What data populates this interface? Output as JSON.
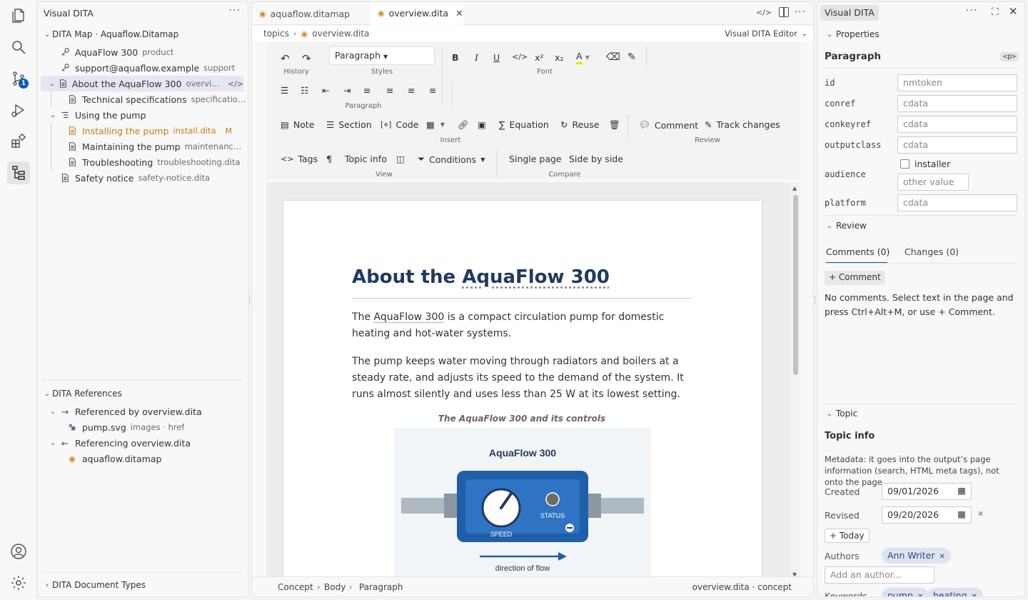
{
  "activity_bar": {
    "scm_badge": "1"
  },
  "sidebar": {
    "title": "Visual DITA",
    "map_section": "DITA Map · Aquaflow.Ditamap",
    "items": [
      {
        "label": "AquaFlow 300",
        "desc": "product"
      },
      {
        "label": "support@aquaflow.example",
        "desc": "support"
      },
      {
        "label": "About the AquaFlow 300",
        "desc": "overview...."
      },
      {
        "label": "Technical specifications",
        "desc": "specifications..."
      },
      {
        "label": "Using the pump",
        "desc": ""
      },
      {
        "label": "Installing the pump",
        "desc": "install.dita",
        "status": "M"
      },
      {
        "label": "Maintaining the pump",
        "desc": "maintenance...."
      },
      {
        "label": "Troubleshooting",
        "desc": "troubleshooting.dita"
      },
      {
        "label": "Safety notice",
        "desc": "safety-notice.dita"
      }
    ],
    "references_section": "DITA References",
    "referenced_by": "Referenced by overview.dita",
    "ref_file": "pump.svg",
    "ref_file_desc": "images · href",
    "referencing": "Referencing overview.dita",
    "referencing_file": "aquaflow.ditamap",
    "doctypes_section": "DITA Document Types"
  },
  "editor": {
    "tabs": [
      {
        "label": "aquaflow.ditamap"
      },
      {
        "label": "overview.dita"
      }
    ],
    "breadcrumb": {
      "folder": "topics",
      "file": "overview.dita",
      "mode": "Visual DITA Editor"
    },
    "ribbon": {
      "history": "History",
      "styles_value": "Paragraph",
      "styles": "Styles",
      "font": "Font",
      "paragraph": "Paragraph",
      "note": "Note",
      "section": "Section",
      "code": "Code",
      "equation": "Equation",
      "reuse": "Reuse",
      "insert": "Insert",
      "comment": "Comment",
      "track_changes": "Track changes",
      "review": "Review",
      "tags": "Tags",
      "pilcrow": "¶",
      "topic_info": "Topic info",
      "conditions": "Conditions",
      "view": "View",
      "single_page": "Single page",
      "side_by_side": "Side by side",
      "compare": "Compare"
    },
    "doc": {
      "title_prefix": "About the ",
      "title_term": "AquaFlow 300",
      "p1_pre": "The ",
      "p1_term": "AquaFlow 300",
      "p1_post": " is a compact circulation pump for domestic heating and hot-water systems.",
      "p2": "The pump keeps water moving through radiators and boilers at a steady rate, and adjusts its speed to the demand of the system. It runs almost silently and uses less than 25 W at its lowest setting.",
      "figure_caption": "The AquaFlow 300 and its controls",
      "figure_title": "AquaFlow 300",
      "figure_speed": "SPEED",
      "figure_status": "STATUS",
      "figure_flow": "direction of flow"
    },
    "status": {
      "path": [
        "Concept",
        "Body",
        "Paragraph"
      ],
      "right": "overview.dita · concept"
    }
  },
  "right_panel": {
    "title": "Visual DITA",
    "properties": "Properties",
    "element": "Paragraph",
    "element_tag": "<p>",
    "attrs": [
      {
        "name": "id",
        "placeholder": "nmtoken"
      },
      {
        "name": "conref",
        "placeholder": "cdata"
      },
      {
        "name": "conkeyref",
        "placeholder": "cdata"
      },
      {
        "name": "outputclass",
        "placeholder": "cdata"
      },
      {
        "name": "audience",
        "checkbox": "installer",
        "placeholder": "other value"
      },
      {
        "name": "platform",
        "placeholder": "cdata"
      }
    ],
    "review": "Review",
    "tab_comments": "Comments (0)",
    "tab_changes": "Changes (0)",
    "add_comment": "+ Comment",
    "no_comments": "No comments. Select text in the page and press Ctrl+Alt+M, or use + Comment.",
    "topic": "Topic",
    "topic_info": "Topic info",
    "metadata_note": "Metadata: it goes into the output’s page information (search, HTML meta tags), not onto the page.",
    "created_label": "Created",
    "created": "09/01/2026",
    "revised_label": "Revised",
    "revised": "09/20/2026",
    "today": "+ Today",
    "authors_label": "Authors",
    "author": "Ann Writer",
    "author_placeholder": "Add an author...",
    "keywords_label": "Keywords",
    "keywords": [
      "pump",
      "heating"
    ]
  }
}
